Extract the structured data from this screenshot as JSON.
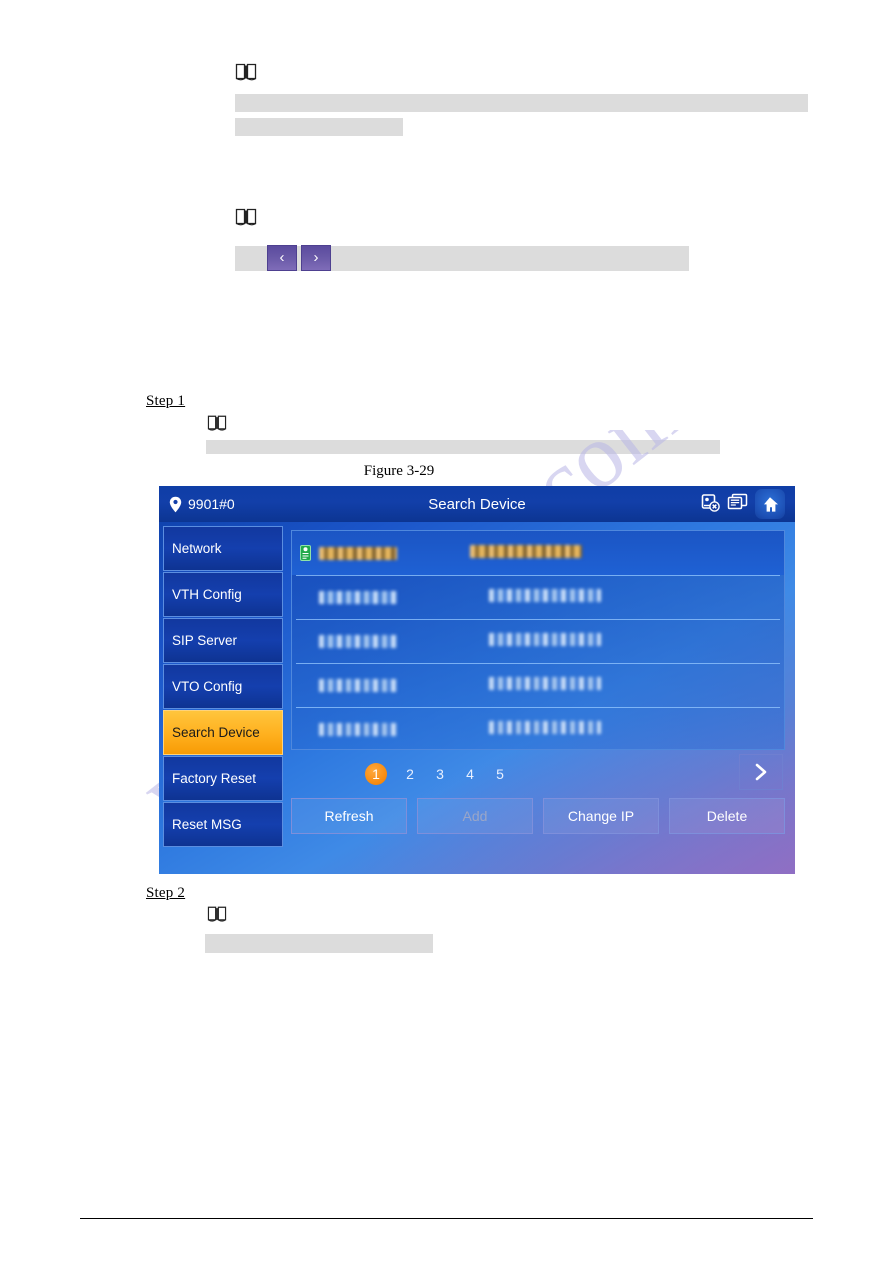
{
  "document": {
    "steps": [
      {
        "label": "Step 1"
      },
      {
        "label": "Step 2"
      }
    ],
    "figure_caption": "Figure 3-29",
    "watermark": "www.dhgate.com",
    "inline_buttons": [
      {
        "glyph": "‹",
        "name": "previous"
      },
      {
        "glyph": "›",
        "name": "next"
      }
    ]
  },
  "device_ui": {
    "header": {
      "room_number": "9901#0",
      "title": "Search Device",
      "icons": [
        "unlock-cancel-icon",
        "monitor-icon",
        "home-icon"
      ]
    },
    "sidebar": {
      "items": [
        {
          "label": "Network",
          "active": false
        },
        {
          "label": "VTH Config",
          "active": false
        },
        {
          "label": "SIP Server",
          "active": false
        },
        {
          "label": "VTO Config",
          "active": false
        },
        {
          "label": "Search Device",
          "active": true
        },
        {
          "label": "Factory Reset",
          "active": false
        },
        {
          "label": "Reset MSG",
          "active": false
        }
      ]
    },
    "device_list": {
      "rows": [
        {
          "selected": true,
          "ip": "redacted",
          "name": "redacted"
        },
        {
          "selected": false,
          "ip": "redacted",
          "name": "redacted"
        },
        {
          "selected": false,
          "ip": "redacted",
          "name": "redacted"
        },
        {
          "selected": false,
          "ip": "redacted",
          "name": "redacted"
        },
        {
          "selected": false,
          "ip": "redacted",
          "name": "redacted"
        }
      ]
    },
    "pagination": {
      "pages": [
        "1",
        "2",
        "3",
        "4",
        "5"
      ],
      "current": "1",
      "next_glyph": "›"
    },
    "buttons": [
      {
        "label": "Refresh",
        "disabled": false
      },
      {
        "label": "Add",
        "disabled": true
      },
      {
        "label": "Change IP",
        "disabled": false
      },
      {
        "label": "Delete",
        "disabled": false
      }
    ],
    "colors": {
      "accent_orange": "#f7890d",
      "active_menu": "#ffb01e",
      "panel_blue": "#1b55c9",
      "title_bar": "#123fa9"
    }
  }
}
